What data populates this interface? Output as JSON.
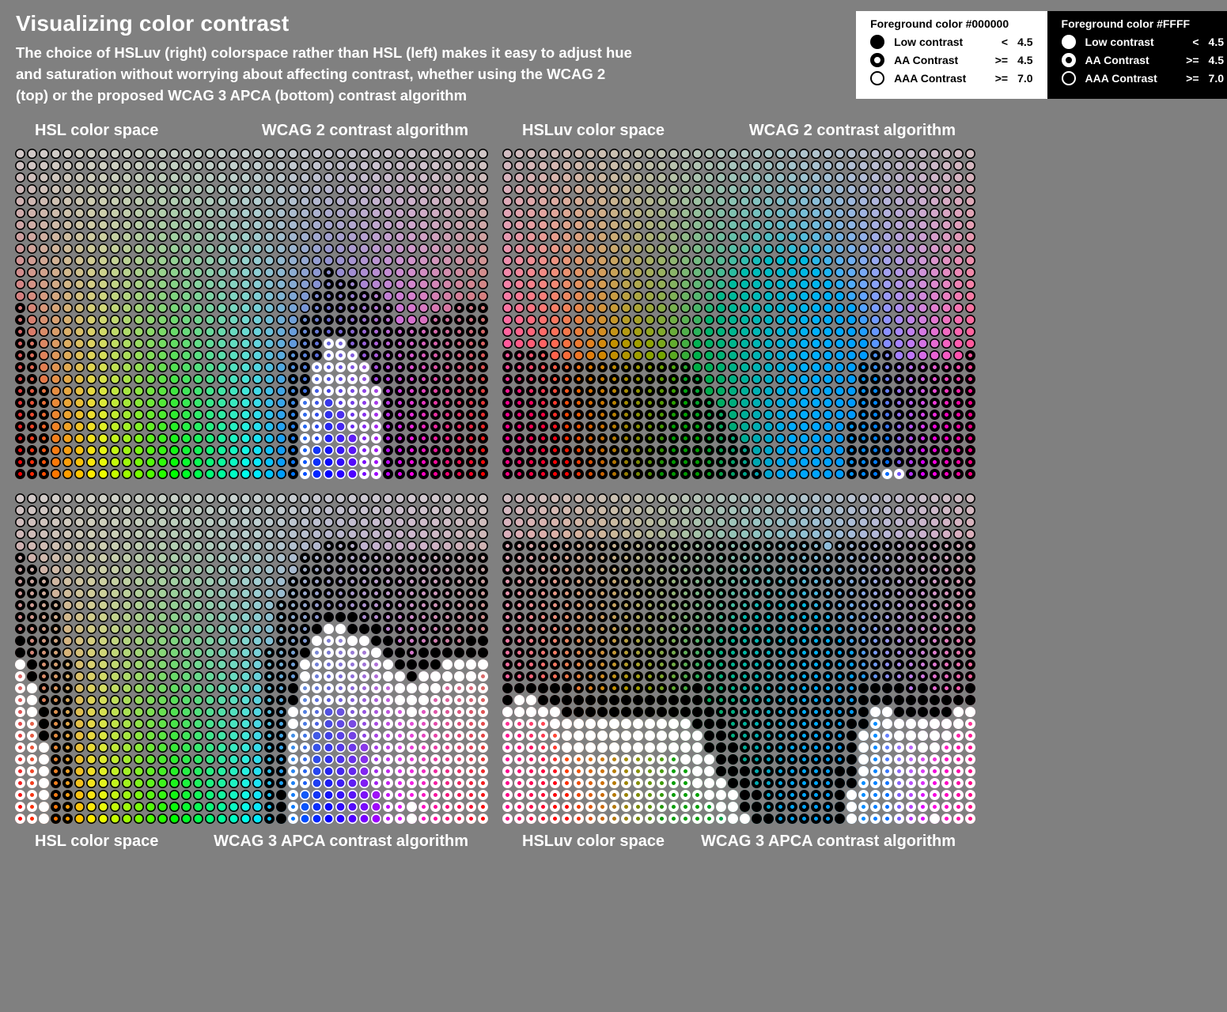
{
  "title": "Visualizing color contrast",
  "subtitle": "The choice of HSLuv (right) colorspace rather than HSL (left) makes it easy to adjust hue and saturation without worrying about affecting contrast, whether using the WCAG 2 (top) or the proposed WCAG 3 APCA (bottom) contrast algorithm",
  "legend": {
    "black_header": "Foreground color #000000",
    "white_header": "Foreground color #FFFF",
    "rows": [
      {
        "label": "Low contrast",
        "op": "<",
        "val": "4.5"
      },
      {
        "label": "AA Contrast",
        "op": ">=",
        "val": "4.5"
      },
      {
        "label": "AAA Contrast",
        "op": ">=",
        "val": "7.0"
      }
    ]
  },
  "panel_labels": {
    "hsl": "HSL color space",
    "hsluv": "HSLuv color space",
    "wcag2": "WCAG 2 contrast algorithm",
    "wcag3": "WCAG 3 APCA contrast algorithm"
  },
  "chart_data": {
    "type": "heatmap",
    "description": "Four grids of circular swatches. X axis = hue 0–360°, Y axis = saturation 0–100% (top) or lightness sweep. Each swatch background is the generated color; the ring shows which foreground (black or white) and which contrast tier applies.",
    "grid": {
      "cols": 40,
      "rows": 28,
      "hue_range": [
        0,
        360
      ],
      "row_range": [
        0,
        100
      ]
    },
    "panels": [
      {
        "id": "hsl-wcag2",
        "colorspace": "HSL",
        "algorithm": "WCAG 2",
        "labels_position": "top"
      },
      {
        "id": "hsluv-wcag2",
        "colorspace": "HSLuv",
        "algorithm": "WCAG 2",
        "labels_position": "top"
      },
      {
        "id": "hsl-wcag3",
        "colorspace": "HSL",
        "algorithm": "WCAG 3 APCA",
        "labels_position": "bottom"
      },
      {
        "id": "hsluv-wcag3",
        "colorspace": "HSLuv",
        "algorithm": "WCAG 3 APCA",
        "labels_position": "bottom"
      }
    ],
    "tiers": {
      "low": {
        "threshold": 4.5,
        "op": "<"
      },
      "aa": {
        "threshold": 4.5,
        "op": ">="
      },
      "aaa": {
        "threshold": 7.0,
        "op": ">="
      }
    }
  }
}
